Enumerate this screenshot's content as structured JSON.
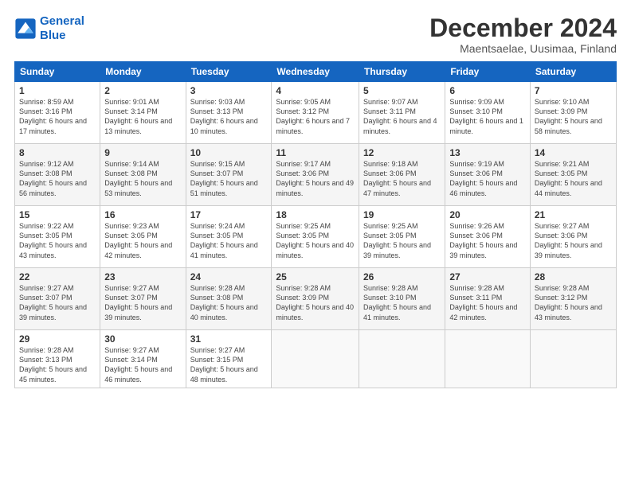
{
  "logo": {
    "line1": "General",
    "line2": "Blue"
  },
  "title": "December 2024",
  "subtitle": "Maentsaelae, Uusimaa, Finland",
  "headers": [
    "Sunday",
    "Monday",
    "Tuesday",
    "Wednesday",
    "Thursday",
    "Friday",
    "Saturday"
  ],
  "weeks": [
    [
      {
        "day": "1",
        "sunrise": "8:59 AM",
        "sunset": "3:16 PM",
        "daylight": "6 hours and 17 minutes."
      },
      {
        "day": "2",
        "sunrise": "9:01 AM",
        "sunset": "3:14 PM",
        "daylight": "6 hours and 13 minutes."
      },
      {
        "day": "3",
        "sunrise": "9:03 AM",
        "sunset": "3:13 PM",
        "daylight": "6 hours and 10 minutes."
      },
      {
        "day": "4",
        "sunrise": "9:05 AM",
        "sunset": "3:12 PM",
        "daylight": "6 hours and 7 minutes."
      },
      {
        "day": "5",
        "sunrise": "9:07 AM",
        "sunset": "3:11 PM",
        "daylight": "6 hours and 4 minutes."
      },
      {
        "day": "6",
        "sunrise": "9:09 AM",
        "sunset": "3:10 PM",
        "daylight": "6 hours and 1 minute."
      },
      {
        "day": "7",
        "sunrise": "9:10 AM",
        "sunset": "3:09 PM",
        "daylight": "5 hours and 58 minutes."
      }
    ],
    [
      {
        "day": "8",
        "sunrise": "9:12 AM",
        "sunset": "3:08 PM",
        "daylight": "5 hours and 56 minutes."
      },
      {
        "day": "9",
        "sunrise": "9:14 AM",
        "sunset": "3:08 PM",
        "daylight": "5 hours and 53 minutes."
      },
      {
        "day": "10",
        "sunrise": "9:15 AM",
        "sunset": "3:07 PM",
        "daylight": "5 hours and 51 minutes."
      },
      {
        "day": "11",
        "sunrise": "9:17 AM",
        "sunset": "3:06 PM",
        "daylight": "5 hours and 49 minutes."
      },
      {
        "day": "12",
        "sunrise": "9:18 AM",
        "sunset": "3:06 PM",
        "daylight": "5 hours and 47 minutes."
      },
      {
        "day": "13",
        "sunrise": "9:19 AM",
        "sunset": "3:06 PM",
        "daylight": "5 hours and 46 minutes."
      },
      {
        "day": "14",
        "sunrise": "9:21 AM",
        "sunset": "3:05 PM",
        "daylight": "5 hours and 44 minutes."
      }
    ],
    [
      {
        "day": "15",
        "sunrise": "9:22 AM",
        "sunset": "3:05 PM",
        "daylight": "5 hours and 43 minutes."
      },
      {
        "day": "16",
        "sunrise": "9:23 AM",
        "sunset": "3:05 PM",
        "daylight": "5 hours and 42 minutes."
      },
      {
        "day": "17",
        "sunrise": "9:24 AM",
        "sunset": "3:05 PM",
        "daylight": "5 hours and 41 minutes."
      },
      {
        "day": "18",
        "sunrise": "9:25 AM",
        "sunset": "3:05 PM",
        "daylight": "5 hours and 40 minutes."
      },
      {
        "day": "19",
        "sunrise": "9:25 AM",
        "sunset": "3:05 PM",
        "daylight": "5 hours and 39 minutes."
      },
      {
        "day": "20",
        "sunrise": "9:26 AM",
        "sunset": "3:06 PM",
        "daylight": "5 hours and 39 minutes."
      },
      {
        "day": "21",
        "sunrise": "9:27 AM",
        "sunset": "3:06 PM",
        "daylight": "5 hours and 39 minutes."
      }
    ],
    [
      {
        "day": "22",
        "sunrise": "9:27 AM",
        "sunset": "3:07 PM",
        "daylight": "5 hours and 39 minutes."
      },
      {
        "day": "23",
        "sunrise": "9:27 AM",
        "sunset": "3:07 PM",
        "daylight": "5 hours and 39 minutes."
      },
      {
        "day": "24",
        "sunrise": "9:28 AM",
        "sunset": "3:08 PM",
        "daylight": "5 hours and 40 minutes."
      },
      {
        "day": "25",
        "sunrise": "9:28 AM",
        "sunset": "3:09 PM",
        "daylight": "5 hours and 40 minutes."
      },
      {
        "day": "26",
        "sunrise": "9:28 AM",
        "sunset": "3:10 PM",
        "daylight": "5 hours and 41 minutes."
      },
      {
        "day": "27",
        "sunrise": "9:28 AM",
        "sunset": "3:11 PM",
        "daylight": "5 hours and 42 minutes."
      },
      {
        "day": "28",
        "sunrise": "9:28 AM",
        "sunset": "3:12 PM",
        "daylight": "5 hours and 43 minutes."
      }
    ],
    [
      {
        "day": "29",
        "sunrise": "9:28 AM",
        "sunset": "3:13 PM",
        "daylight": "5 hours and 45 minutes."
      },
      {
        "day": "30",
        "sunrise": "9:27 AM",
        "sunset": "3:14 PM",
        "daylight": "5 hours and 46 minutes."
      },
      {
        "day": "31",
        "sunrise": "9:27 AM",
        "sunset": "3:15 PM",
        "daylight": "5 hours and 48 minutes."
      },
      null,
      null,
      null,
      null
    ]
  ]
}
